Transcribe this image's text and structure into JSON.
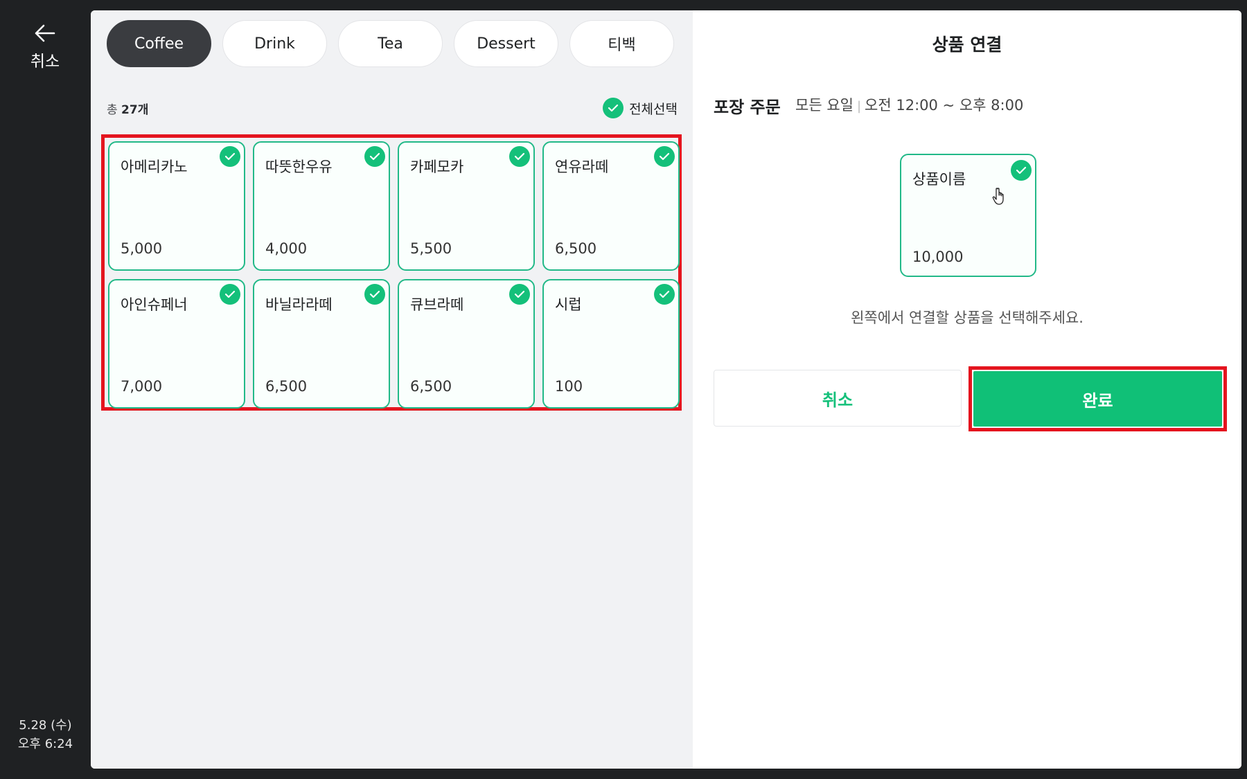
{
  "sidebar": {
    "back_label": "취소",
    "date": "5.28 (수)",
    "time": "오후 6:24"
  },
  "tabs": [
    {
      "label": "Coffee",
      "active": true
    },
    {
      "label": "Drink",
      "active": false
    },
    {
      "label": "Tea",
      "active": false
    },
    {
      "label": "Dessert",
      "active": false
    },
    {
      "label": "티백",
      "active": false
    }
  ],
  "list": {
    "count_prefix": "총",
    "count_value": "27개",
    "select_all_label": "전체선택"
  },
  "products": [
    {
      "name": "아메리카노",
      "price": "5,000",
      "checked": true
    },
    {
      "name": "따뜻한우유",
      "price": "4,000",
      "checked": true
    },
    {
      "name": "카페모카",
      "price": "5,500",
      "checked": true
    },
    {
      "name": "연유라떼",
      "price": "6,500",
      "checked": true
    },
    {
      "name": "아인슈페너",
      "price": "7,000",
      "checked": true
    },
    {
      "name": "바닐라라떼",
      "price": "6,500",
      "checked": true
    },
    {
      "name": "큐브라떼",
      "price": "6,500",
      "checked": true
    },
    {
      "name": "시럽",
      "price": "100",
      "checked": true
    }
  ],
  "link_panel": {
    "title": "상품 연결",
    "order_type": "포장 주문",
    "days": "모든 요일",
    "hours": "오전 12:00 ~ 오후  8:00",
    "linked_product": {
      "name": "상품이름",
      "price": "10,000",
      "checked": true
    },
    "hint": "왼쪽에서 연결할 상품을 선택해주세요.",
    "cancel_label": "취소",
    "done_label": "완료"
  },
  "colors": {
    "accent": "#10c077",
    "card_border": "#22b988",
    "highlight": "#e4151f",
    "active_tab": "#3a3c40",
    "rail": "#1f2123"
  }
}
